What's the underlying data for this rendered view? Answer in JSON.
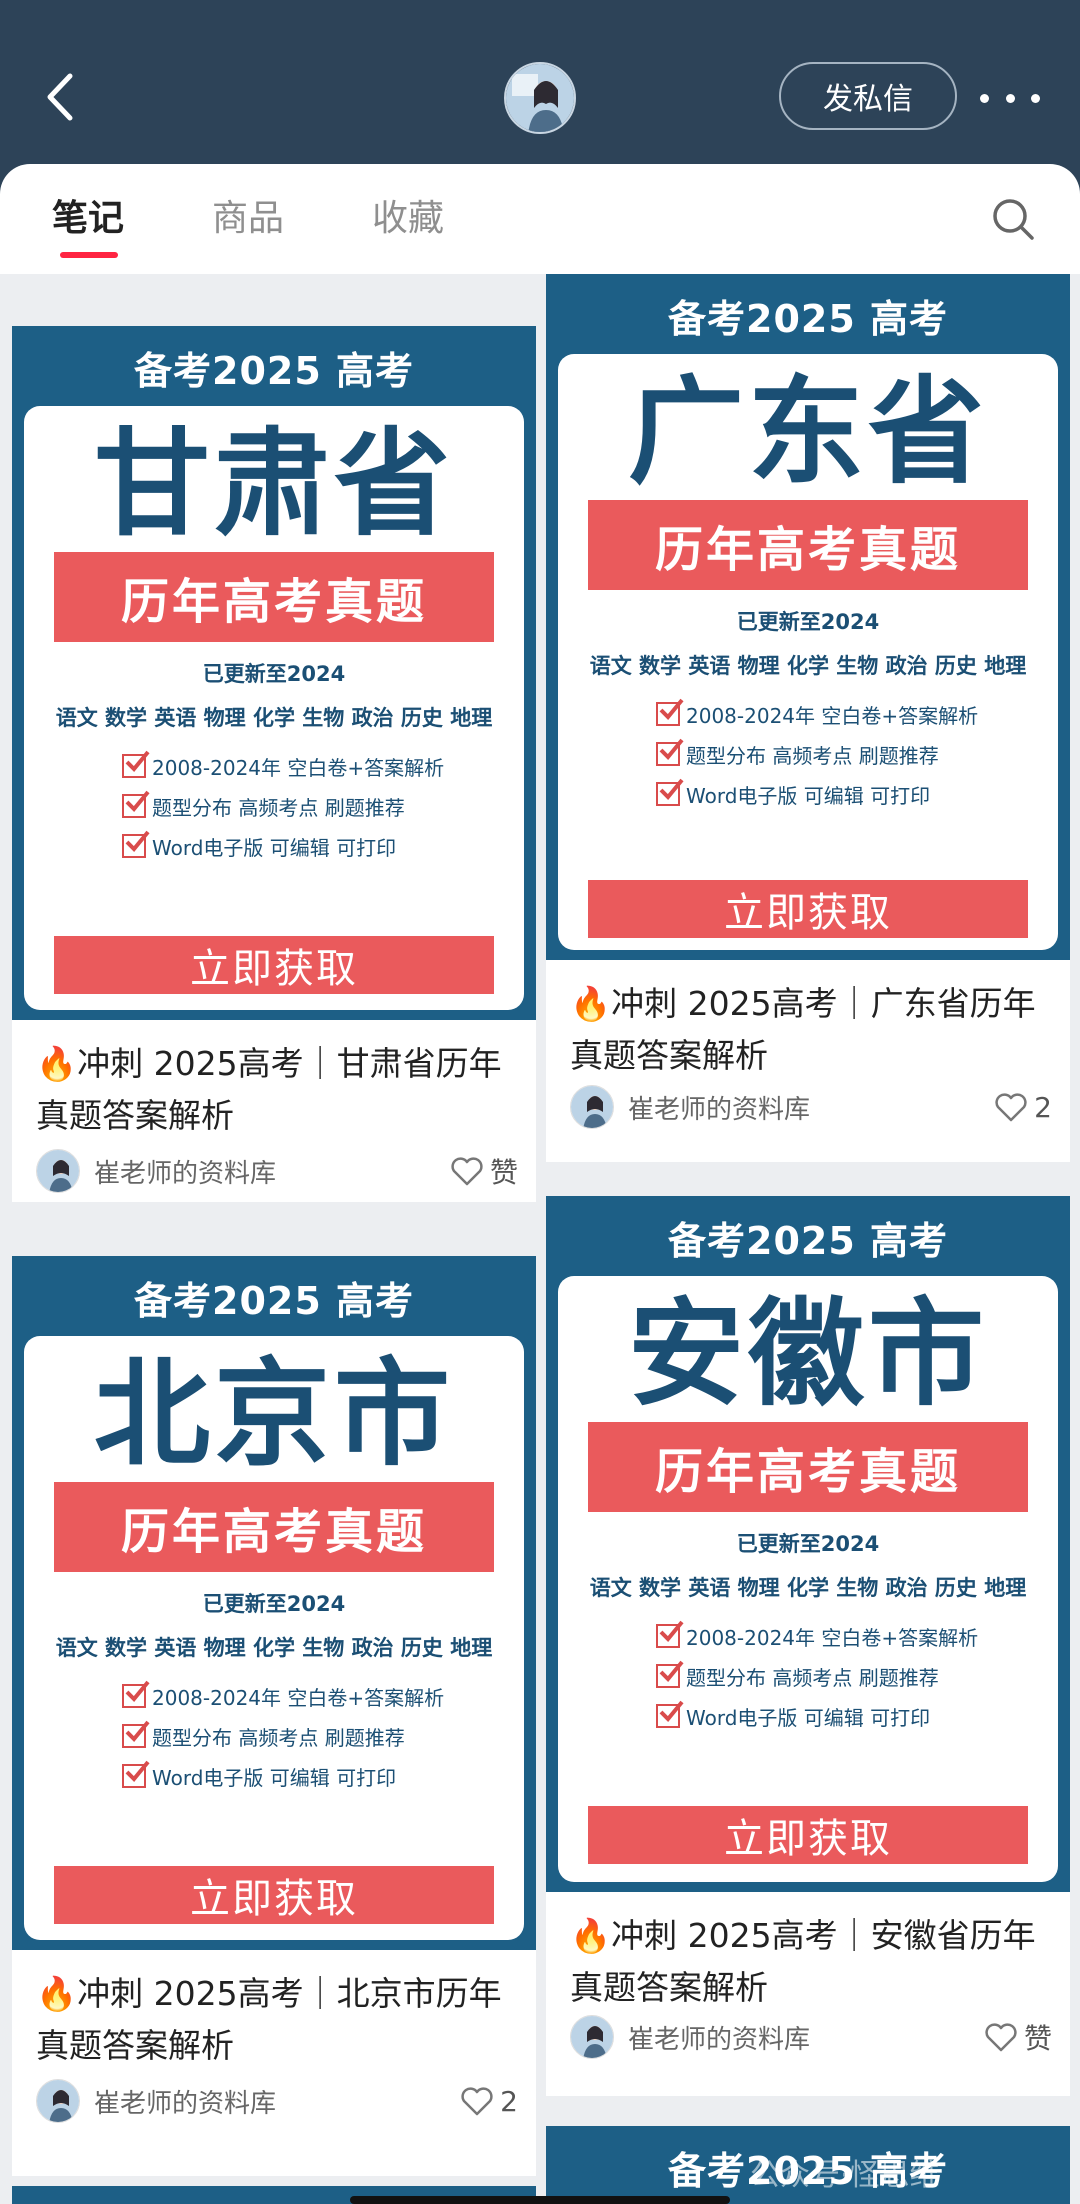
{
  "header": {
    "follow_dm_label": "发私信",
    "colors": {
      "bar": "#2d4358"
    }
  },
  "tabs": [
    {
      "label": "笔记",
      "active": true
    },
    {
      "label": "商品",
      "active": false
    },
    {
      "label": "收藏",
      "active": false
    }
  ],
  "icons": [
    "back-arrow-icon",
    "avatar",
    "more-dots-icon",
    "search-icon",
    "heart-icon",
    "fire-emoji-icon",
    "checkbox-checked-icon"
  ],
  "poster_common": {
    "head": "备考2025 高考",
    "banner": "历年高考真题",
    "updated": "已更新至2024",
    "subjects": "语文 数学 英语 物理 化学 生物 政治 历史 地理",
    "features": [
      "2008-2024年 空白卷+答案解析",
      "题型分布 高频考点 刷题推荐",
      "Word电子版 可编辑 可打印"
    ],
    "cta": "立即获取",
    "colors": {
      "frame": "#1d5f86",
      "text": "#1b4f74",
      "accent": "#ea5a5c"
    }
  },
  "cards": [
    {
      "province": "甘肃省",
      "fire": "🔥",
      "title": "冲刺 2025高考｜甘肃省历年真题答案解析",
      "author": "崔老师的资料库",
      "likes": "赞"
    },
    {
      "province": "广东省",
      "fire": "🔥",
      "title": "冲刺 2025高考｜广东省历年真题答案解析",
      "author": "崔老师的资料库",
      "likes": "2"
    },
    {
      "province": "北京市",
      "fire": "🔥",
      "title": "冲刺 2025高考｜北京市历年真题答案解析",
      "author": "崔老师的资料库",
      "likes": "2"
    },
    {
      "province": "安徽市",
      "fire": "🔥",
      "title": "冲刺 2025高考｜安徽省历年真题答案解析",
      "author": "崔老师的资料库",
      "likes": "赞"
    }
  ],
  "partial_bottom_poster_head": "备考2025 高考",
  "watermark": "公众号·怪思维"
}
